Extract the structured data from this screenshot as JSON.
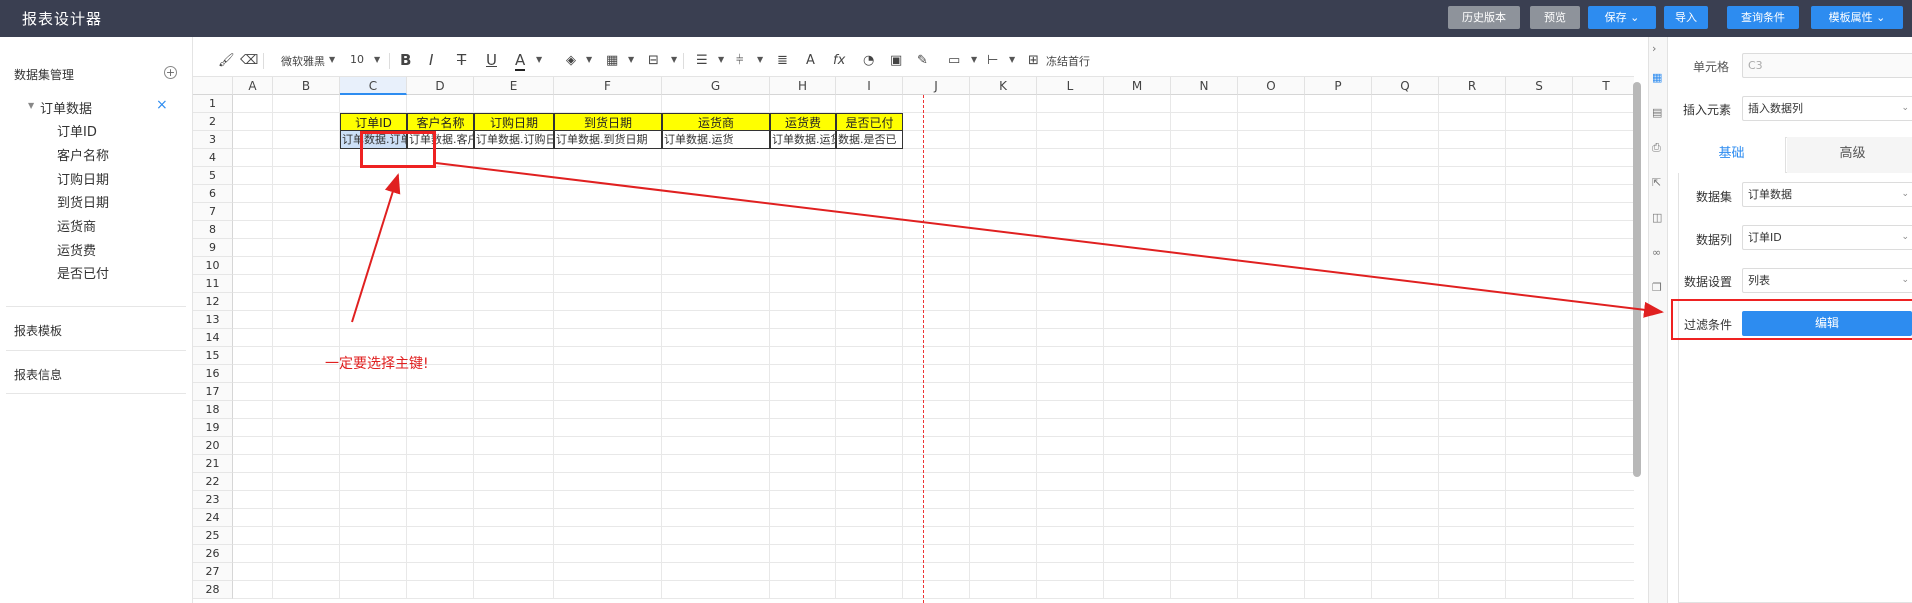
{
  "app_title": "报表设计器",
  "topbar": {
    "history": "历史版本",
    "preview": "预览",
    "save": "保存",
    "import": "导入",
    "query": "查询条件",
    "template_props": "模板属性"
  },
  "left": {
    "dataset_mgmt": "数据集管理",
    "add_icon": "plus-circle-icon",
    "dataset": "订单数据",
    "fields": [
      "订单ID",
      "客户名称",
      "订购日期",
      "到货日期",
      "运货商",
      "运货费",
      "是否已付"
    ],
    "report_template": "报表模板",
    "report_info": "报表信息"
  },
  "toolbar": {
    "font": "微软雅黑",
    "size": "10",
    "bold": "B",
    "italic": "I",
    "strike": "T",
    "underline": "U",
    "fontcolor": "A",
    "fx": "fx",
    "freeze": "冻结首行"
  },
  "columns": [
    "A",
    "B",
    "C",
    "D",
    "E",
    "F",
    "G",
    "H",
    "I",
    "J",
    "K",
    "L",
    "M",
    "N",
    "O",
    "P",
    "Q",
    "R",
    "S",
    "T"
  ],
  "rows": [
    "1",
    "2",
    "3",
    "4",
    "5",
    "6",
    "7",
    "8",
    "9",
    "10",
    "11",
    "12",
    "13",
    "14",
    "15",
    "16",
    "17",
    "18",
    "19",
    "20",
    "21",
    "22",
    "23",
    "24",
    "25",
    "26",
    "27",
    "28"
  ],
  "headers": [
    "订单ID",
    "客户名称",
    "订购日期",
    "到货日期",
    "运货商",
    "运货费",
    "是否已付"
  ],
  "data_cells": [
    "订单数据.订单",
    "订单数据.客户名",
    "订单数据.订购日期",
    "订单数据.到货日期",
    "订单数据.运货",
    "订单数据.运货",
    "数据.是否已"
  ],
  "annotation": "一定要选择主键!",
  "props": {
    "cell_label": "单元格",
    "cell_value": "C3",
    "insert_label": "插入元素",
    "insert_value": "插入数据列",
    "tab_basic": "基础",
    "tab_advanced": "高级",
    "dataset_label": "数据集",
    "dataset_value": "订单数据",
    "column_label": "数据列",
    "column_value": "订单ID",
    "datasetting_label": "数据设置",
    "datasetting_value": "列表",
    "filter_label": "过滤条件",
    "edit": "编辑"
  },
  "colors": {
    "topbar": "#3a3f51",
    "accent": "#2d8cf0",
    "header_fill": "#ffff00",
    "annotation": "#e02020"
  }
}
